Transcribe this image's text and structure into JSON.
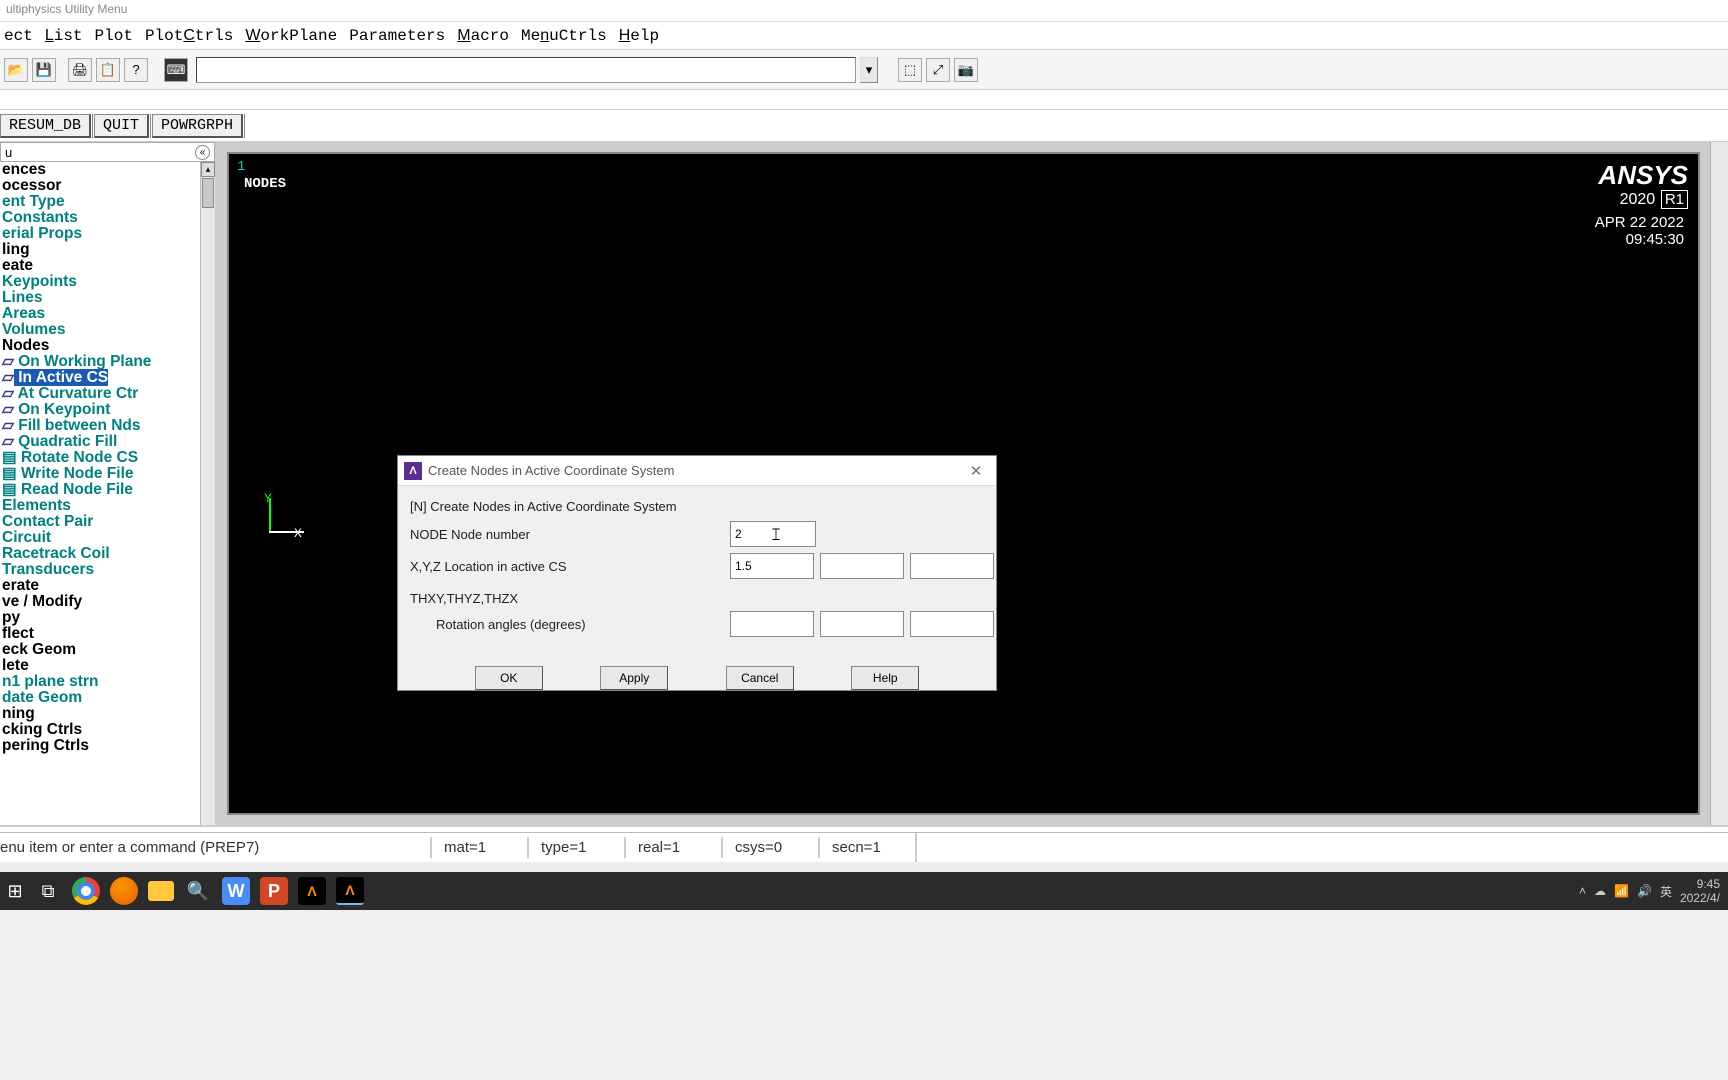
{
  "window_title": "ultiphysics Utility Menu",
  "menu": {
    "select": "ect",
    "list": "List",
    "plot": "Plot",
    "plotctrls": "PlotCtrls",
    "workplane": "WorkPlane",
    "parameters": "Parameters",
    "macro": "Macro",
    "menuctrls": "MenuCtrls",
    "help": "Help"
  },
  "raised_buttons": {
    "resum": "RESUM_DB",
    "quit": "QUIT",
    "powrgrph": "POWRGRPH"
  },
  "tree_header_char": "u",
  "tree": [
    {
      "text": "ences",
      "cls": "black"
    },
    {
      "text": "ocessor",
      "cls": "black"
    },
    {
      "text": "ent Type",
      "cls": "green"
    },
    {
      "text": " Constants",
      "cls": "green"
    },
    {
      "text": "erial Props",
      "cls": "green"
    },
    {
      "text": "ling",
      "cls": "black"
    },
    {
      "text": "eate",
      "cls": "black"
    },
    {
      "text": "Keypoints",
      "cls": "green"
    },
    {
      "text": "Lines",
      "cls": "green"
    },
    {
      "text": "Areas",
      "cls": "green"
    },
    {
      "text": "Volumes",
      "cls": "green"
    },
    {
      "text": "Nodes",
      "cls": "black"
    },
    {
      "text": " On Working Plane",
      "cls": "green",
      "icon": "arrow"
    },
    {
      "text": " In Active CS",
      "cls": "selected",
      "icon": "arrow"
    },
    {
      "text": " At Curvature Ctr",
      "cls": "green",
      "icon": "arrow"
    },
    {
      "text": " On Keypoint",
      "cls": "green",
      "icon": "arrow"
    },
    {
      "text": " Fill between Nds",
      "cls": "green",
      "icon": "arrow"
    },
    {
      "text": " Quadratic Fill",
      "cls": "green",
      "icon": "arrow"
    },
    {
      "text": " Rotate Node CS",
      "cls": "green",
      "icon": "doc"
    },
    {
      "text": " Write Node File",
      "cls": "green",
      "icon": "doc"
    },
    {
      "text": " Read Node File",
      "cls": "green",
      "icon": "doc"
    },
    {
      "text": "Elements",
      "cls": "green"
    },
    {
      "text": "Contact Pair",
      "cls": "green"
    },
    {
      "text": "Circuit",
      "cls": "green"
    },
    {
      "text": "Racetrack Coil",
      "cls": "green"
    },
    {
      "text": "Transducers",
      "cls": "green"
    },
    {
      "text": "erate",
      "cls": "black"
    },
    {
      "text": "ve / Modify",
      "cls": "black"
    },
    {
      "text": "py",
      "cls": "black"
    },
    {
      "text": "flect",
      "cls": "black"
    },
    {
      "text": "eck Geom",
      "cls": "black"
    },
    {
      "text": "lete",
      "cls": "black"
    },
    {
      "text": "n1 plane strn",
      "cls": "green"
    },
    {
      "text": "date Geom",
      "cls": "green"
    },
    {
      "text": "ning",
      "cls": "black"
    },
    {
      "text": "cking Ctrls",
      "cls": "black"
    },
    {
      "text": "pering Ctrls",
      "cls": "black"
    }
  ],
  "gfx": {
    "num1": "1",
    "nodes_label": "NODES",
    "brand": "ANSYS",
    "version_year": "2020",
    "release": "R1",
    "date": "APR 22 2022",
    "time": "09:45:30",
    "axis_y": "Y",
    "axis_x": "X"
  },
  "dialog": {
    "title": "Create Nodes in Active Coordinate System",
    "subtitle": "[N]  Create Nodes in Active Coordinate System",
    "node_label": "NODE   Node number",
    "node_value": "2",
    "xyz_label": "X,Y,Z  Location in active CS",
    "x_value": "1.5",
    "y_value": "",
    "z_value": "",
    "rot_heading": "THXY,THYZ,THZX",
    "rot_label": "Rotation angles (degrees)",
    "thxy": "",
    "thyz": "",
    "thzx": "",
    "ok": "OK",
    "apply": "Apply",
    "cancel": "Cancel",
    "help": "Help"
  },
  "status": {
    "prompt": "enu item or enter a command (PREP7)",
    "mat": "mat=1",
    "type": "type=1",
    "real": "real=1",
    "csys": "csys=0",
    "secn": "secn=1"
  },
  "tray": {
    "ime": "英",
    "time": "9:45",
    "date": "2022/4/"
  }
}
